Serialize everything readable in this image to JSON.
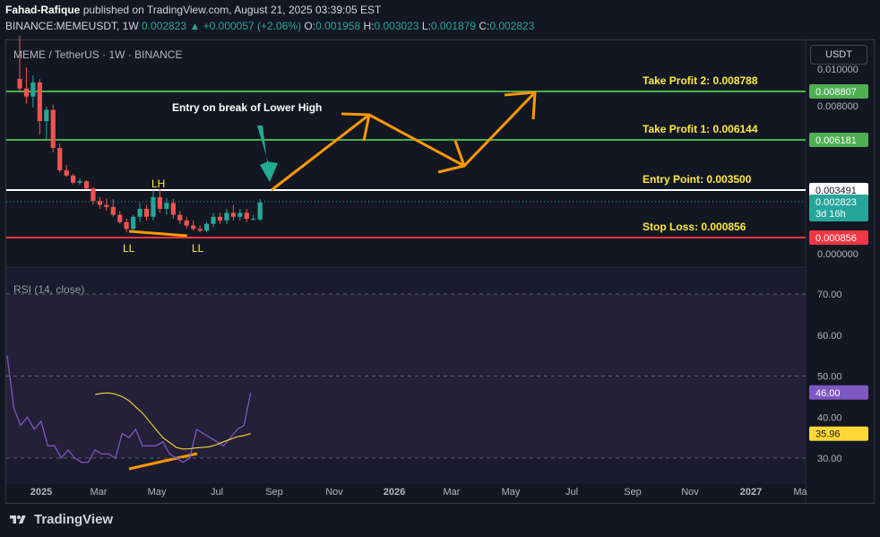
{
  "header": {
    "author": "Fahad-Rafique",
    "published_text": "published on TradingView.com, August 21, 2025 03:39:05 EST",
    "symbol_line": "BINANCE:MEMEUSDT, 1W",
    "last": "0.002823",
    "change": "▲ +0.000057 (+2.06%)",
    "o_label": "O:",
    "o": "0.001958",
    "h_label": "H:",
    "h": "0.003023",
    "l_label": "L:",
    "l": "0.001879",
    "c_label": "C:",
    "c": "0.002823"
  },
  "chart_title": "MEME / TetherUS · 1W · BINANCE",
  "currency_button": "USDT",
  "footer_brand": "TradingView",
  "colors": {
    "background": "#131722",
    "up": "#26a69a",
    "down": "#ef5350",
    "take_profit_line": "#4caf50",
    "entry_line": "#ffffff",
    "stop_line": "#f23645",
    "annotation": "#ffeb3b",
    "arrow": "#ff9800",
    "rsi": "#7e57c2",
    "rsi_ma": "#fdd835",
    "teal_arrow": "#22ab94"
  },
  "chart_data": [
    {
      "type": "candlestick",
      "title": "MEME / TetherUS · 1W · BINANCE",
      "y_scale": "custom (price axis labels as shown)",
      "price_ticks": [
        "0.010000",
        "0.008000",
        "0.000000"
      ],
      "x_ticks": [
        "2025",
        "Mar",
        "May",
        "Jul",
        "Sep",
        "Nov",
        "2026",
        "Mar",
        "May",
        "Jul",
        "Sep",
        "Nov",
        "2027",
        "Ma"
      ],
      "candles": [
        {
          "o": 0.0128,
          "h": 0.0165,
          "l": 0.0115,
          "c": 0.0119
        },
        {
          "o": 0.0119,
          "h": 0.0138,
          "l": 0.0104,
          "c": 0.0111
        },
        {
          "o": 0.0111,
          "h": 0.0131,
          "l": 0.01,
          "c": 0.0125
        },
        {
          "o": 0.0125,
          "h": 0.0128,
          "l": 0.0088,
          "c": 0.0094
        },
        {
          "o": 0.0094,
          "h": 0.0101,
          "l": 0.0086,
          "c": 0.0099
        },
        {
          "o": 0.0099,
          "h": 0.0103,
          "l": 0.008,
          "c": 0.0082
        },
        {
          "o": 0.0082,
          "h": 0.0084,
          "l": 0.0062,
          "c": 0.0064
        },
        {
          "o": 0.0064,
          "h": 0.0069,
          "l": 0.0057,
          "c": 0.0059
        },
        {
          "o": 0.0059,
          "h": 0.0061,
          "l": 0.0047,
          "c": 0.0049
        },
        {
          "o": 0.0049,
          "h": 0.0055,
          "l": 0.0046,
          "c": 0.0051
        },
        {
          "o": 0.0051,
          "h": 0.0052,
          "l": 0.004,
          "c": 0.0041
        },
        {
          "o": 0.0041,
          "h": 0.0043,
          "l": 0.0027,
          "c": 0.0029
        },
        {
          "o": 0.0029,
          "h": 0.0032,
          "l": 0.0025,
          "c": 0.0027
        },
        {
          "o": 0.0027,
          "h": 0.0031,
          "l": 0.0024,
          "c": 0.0026
        },
        {
          "o": 0.0026,
          "h": 0.003,
          "l": 0.0021,
          "c": 0.0022
        },
        {
          "o": 0.0022,
          "h": 0.0024,
          "l": 0.0017,
          "c": 0.0018
        },
        {
          "o": 0.0018,
          "h": 0.002,
          "l": 0.0012,
          "c": 0.0014
        },
        {
          "o": 0.0014,
          "h": 0.0022,
          "l": 0.0012,
          "c": 0.0021
        },
        {
          "o": 0.0021,
          "h": 0.0028,
          "l": 0.0018,
          "c": 0.0025
        },
        {
          "o": 0.0025,
          "h": 0.0027,
          "l": 0.0019,
          "c": 0.0021
        },
        {
          "o": 0.0021,
          "h": 0.0039,
          "l": 0.0019,
          "c": 0.0032
        },
        {
          "o": 0.0032,
          "h": 0.004,
          "l": 0.0023,
          "c": 0.0025
        },
        {
          "o": 0.0025,
          "h": 0.0031,
          "l": 0.0022,
          "c": 0.0028
        },
        {
          "o": 0.0028,
          "h": 0.003,
          "l": 0.002,
          "c": 0.0022
        },
        {
          "o": 0.0022,
          "h": 0.0024,
          "l": 0.0017,
          "c": 0.0019
        },
        {
          "o": 0.0019,
          "h": 0.0021,
          "l": 0.0014,
          "c": 0.0016
        },
        {
          "o": 0.0016,
          "h": 0.0019,
          "l": 0.0013,
          "c": 0.0014
        },
        {
          "o": 0.0014,
          "h": 0.0016,
          "l": 0.0012,
          "c": 0.0013
        },
        {
          "o": 0.0013,
          "h": 0.0018,
          "l": 0.0012,
          "c": 0.0017
        },
        {
          "o": 0.0017,
          "h": 0.0023,
          "l": 0.0015,
          "c": 0.0021
        },
        {
          "o": 0.0021,
          "h": 0.0023,
          "l": 0.0017,
          "c": 0.0019
        },
        {
          "o": 0.0019,
          "h": 0.0025,
          "l": 0.0017,
          "c": 0.0023
        },
        {
          "o": 0.0023,
          "h": 0.0027,
          "l": 0.0019,
          "c": 0.0021
        },
        {
          "o": 0.0021,
          "h": 0.0025,
          "l": 0.0019,
          "c": 0.0023
        },
        {
          "o": 0.0023,
          "h": 0.0025,
          "l": 0.0018,
          "c": 0.002
        },
        {
          "o": 0.002,
          "h": 0.0022,
          "l": 0.0019,
          "c": 0.002
        },
        {
          "o": 0.001958,
          "h": 0.003023,
          "l": 0.001879,
          "c": 0.002823
        }
      ],
      "levels": [
        {
          "name": "Take Profit 2",
          "label": "Take Profit 2: 0.008788",
          "value": 0.008788,
          "badge": "0.008807",
          "kind": "tp"
        },
        {
          "name": "Take Profit 1",
          "label": "Take Profit 1: 0.006144",
          "value": 0.006144,
          "badge": "0.006181",
          "kind": "tp"
        },
        {
          "name": "Entry Point",
          "label": "Entry Point: 0.003500",
          "value": 0.0035,
          "badge": "0.003491",
          "kind": "entry"
        },
        {
          "name": "Stop Loss",
          "label": "Stop Loss: 0.000856",
          "value": 0.000856,
          "badge": "0.000856",
          "kind": "stop"
        }
      ],
      "current_price_badge": "0.002823",
      "countdown": "3d 16h",
      "annotations": {
        "entry_text": "Entry on break of Lower High",
        "lh": "LH",
        "ll_left": "LL",
        "ll_right": "LL"
      }
    },
    {
      "type": "line",
      "title": "RSI (14, close)",
      "y_ticks": [
        "70.00",
        "60.00",
        "50.00",
        "40.00",
        "30.00"
      ],
      "ylim": [
        27,
        73
      ],
      "rsi_values": [
        55,
        42,
        38,
        40,
        37,
        39,
        33,
        33,
        30,
        32,
        30,
        29,
        29,
        32,
        31,
        31,
        30,
        36,
        35,
        37,
        33,
        33,
        33,
        34,
        31,
        30,
        29,
        30,
        37,
        36,
        35,
        34,
        33,
        35,
        37,
        38,
        46
      ],
      "rsi_ma_values": [
        null,
        null,
        null,
        null,
        null,
        null,
        null,
        null,
        null,
        null,
        null,
        null,
        null,
        45.5,
        45.8,
        45.9,
        45.6,
        45.0,
        44.0,
        42.5,
        41.0,
        39.0,
        37.0,
        35.0,
        33.8,
        32.6,
        32.2,
        32.3,
        32.5,
        32.6,
        32.8,
        33.3,
        34.0,
        34.6,
        35.2,
        35.5,
        35.96
      ],
      "rsi_badge": "46.00",
      "ma_badge": "35.96"
    }
  ]
}
